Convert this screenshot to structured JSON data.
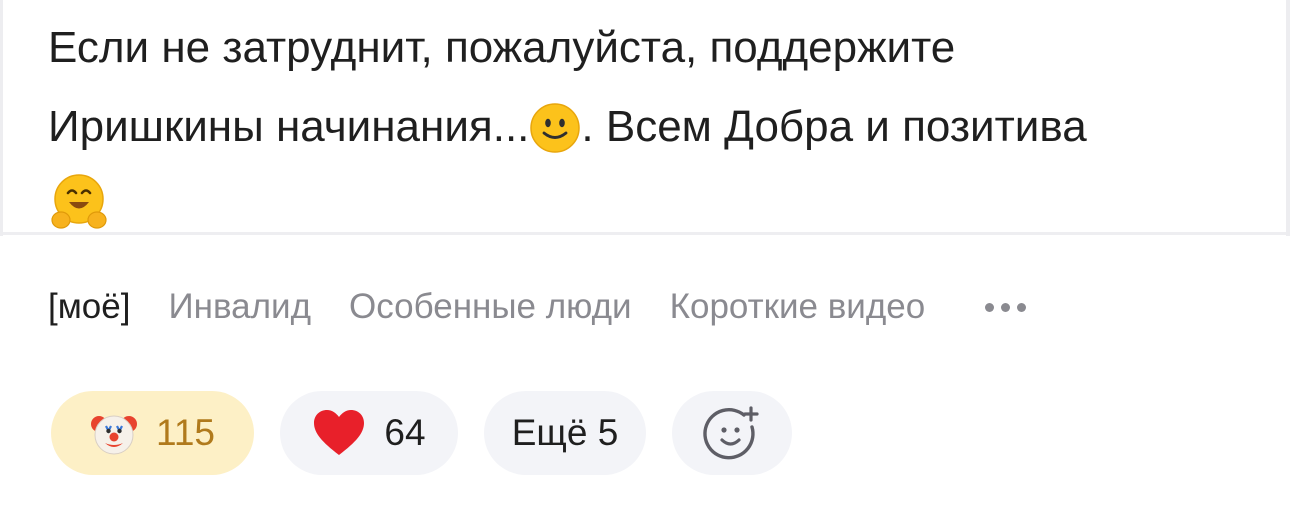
{
  "post": {
    "line1": "Если не затруднит, пожалуйста, поддержите",
    "line2_before": "Иришкины начинания...",
    "line2_after": ". Всем Добра и позитива",
    "emoji_inline": "slightly-smiling-face",
    "emoji_end": "hugging-face"
  },
  "tags": {
    "own": "[моё]",
    "items": [
      "Инвалид",
      "Особенные люди",
      "Короткие видео"
    ],
    "more_icon": "more-dots-icon"
  },
  "reactions": {
    "clown": {
      "icon": "clown-face",
      "count": "115",
      "bg": "#fdf0c6",
      "color": "#b07a1c"
    },
    "heart": {
      "icon": "red-heart",
      "count": "64"
    },
    "more_label": "Ещё 5",
    "add_icon": "add-reaction-icon"
  }
}
